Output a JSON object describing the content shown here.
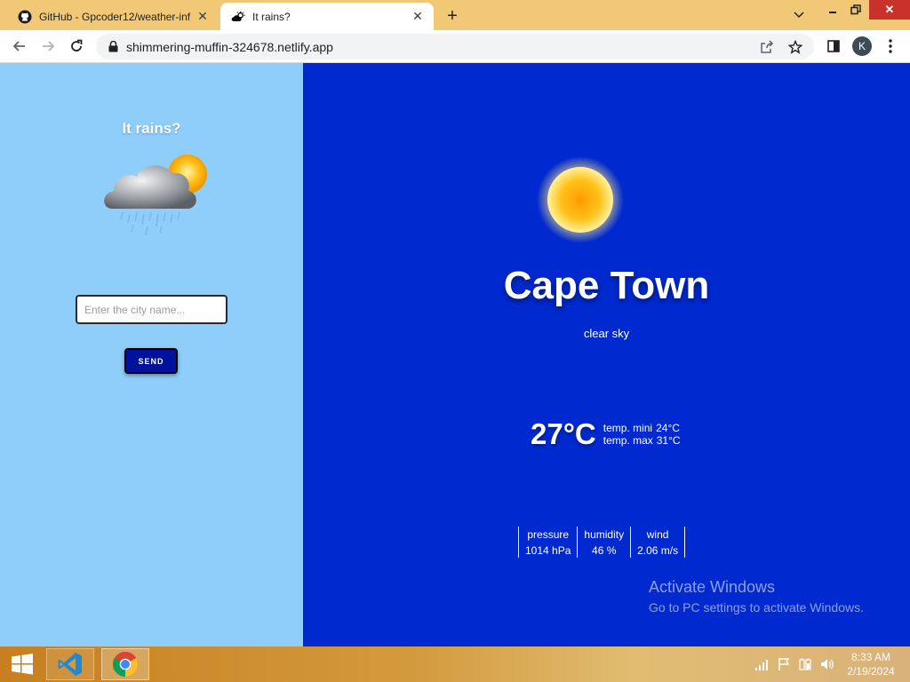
{
  "browser": {
    "tabs": [
      {
        "title": "GitHub - Gpcoder12/weather-inf",
        "icon": "github-icon",
        "active": false
      },
      {
        "title": "It rains?",
        "icon": "weather-cloud-sun-icon",
        "active": true
      }
    ],
    "url": "shimmering-muffin-324678.netlify.app",
    "profile_initial": "K"
  },
  "app": {
    "title": "It rains?",
    "logo": "cloud-sun-rain-icon",
    "search": {
      "placeholder": "Enter the city name...",
      "value": ""
    },
    "send_label": "SEND"
  },
  "weather": {
    "icon": "sun-icon",
    "city": "Cape Town",
    "condition": "clear sky",
    "temperature": "27°C",
    "temp_min_label": "temp. mini",
    "temp_min": "24°C",
    "temp_max_label": "temp. max",
    "temp_max": "31°C",
    "stats": [
      {
        "label": "pressure",
        "value": "1014 hPa"
      },
      {
        "label": "humidity",
        "value": "46 %"
      },
      {
        "label": "wind",
        "value": "2.06 m/s"
      }
    ]
  },
  "watermark": {
    "title": "Activate Windows",
    "subtitle": "Go to PC settings to activate Windows."
  },
  "taskbar": {
    "apps": [
      "windows-start-icon",
      "vscode-icon",
      "chrome-icon"
    ],
    "time": "8:33 AM",
    "date": "2/19/2024"
  },
  "colors": {
    "left_panel": "#8fcdfa",
    "right_panel": "#0029cf",
    "send_button": "#00129b",
    "tab_strip": "#f1c976"
  }
}
